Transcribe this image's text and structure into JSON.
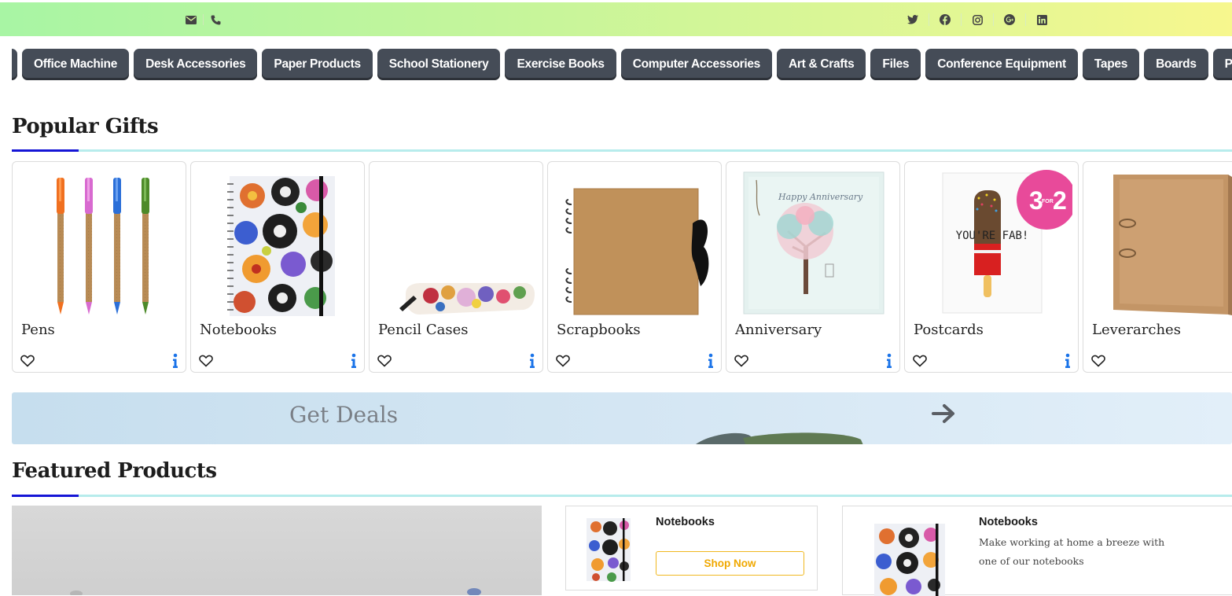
{
  "topbar": {
    "contact_icons": [
      "envelope-icon",
      "phone-icon"
    ],
    "social_icons": [
      "twitter-icon",
      "facebook-icon",
      "instagram-icon",
      "google-plus-icon",
      "linkedin-icon"
    ]
  },
  "categories": [
    "Office Machine",
    "Desk Accessories",
    "Paper Products",
    "School Stationery",
    "Exercise Books",
    "Computer Accessories",
    "Art & Crafts",
    "Files",
    "Conference Equipment",
    "Tapes",
    "Boards",
    "Personal"
  ],
  "popular_gifts": {
    "title": "Popular Gifts",
    "items": [
      {
        "name": "Pens"
      },
      {
        "name": "Notebooks"
      },
      {
        "name": "Pencil Cases"
      },
      {
        "name": "Scrapbooks"
      },
      {
        "name": "Anniversary"
      },
      {
        "name": "Postcards",
        "badge": "3 FOR 2"
      },
      {
        "name": "Leverarches"
      }
    ],
    "image_texts": {
      "anniversary_card": "Happy Anniversary",
      "postcard": "YOU'RE FAB!",
      "badge_big_left": "3",
      "badge_small": "FOR",
      "badge_big_right": "2"
    }
  },
  "deals_banner": {
    "text": "Get Deals"
  },
  "featured": {
    "title": "Featured Products",
    "cards": [
      {
        "title": "Notebooks",
        "button": "Shop Now"
      },
      {
        "title": "Notebooks",
        "description": "Make working at home a breeze with one of our notebooks"
      }
    ]
  },
  "colors": {
    "pill_bg": "#454c57",
    "accent_blue": "#1515d6",
    "line_teal": "#b7ecec",
    "button_yellow": "#f0b820",
    "info_blue": "#1a73e8"
  }
}
